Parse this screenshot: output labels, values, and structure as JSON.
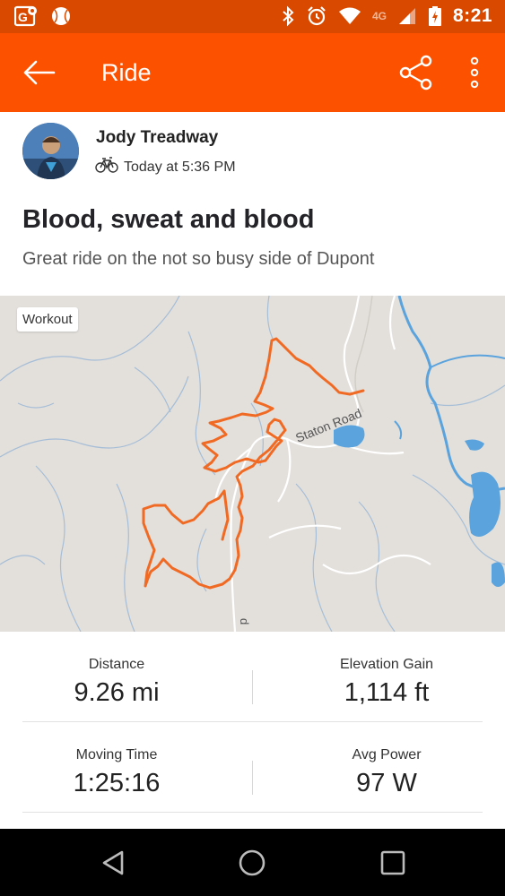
{
  "status_bar": {
    "time": "8:21",
    "network": "4G",
    "left_icons": [
      "google-maps-icon",
      "baseball-icon"
    ],
    "right_icons": [
      "bluetooth-icon",
      "alarm-icon",
      "wifi-icon",
      "signal-icon",
      "battery-icon"
    ]
  },
  "app_bar": {
    "title": "Ride",
    "background": "#fc5200",
    "icons": [
      "back-arrow-icon",
      "share-icon",
      "more-vert-icon"
    ]
  },
  "athlete": {
    "name": "Jody Treadway",
    "activity_icon": "bike-icon",
    "timestamp": "Today at 5:36 PM"
  },
  "activity": {
    "title": "Blood, sweat and blood",
    "description": "Great ride on the not so busy side of Dupont"
  },
  "map": {
    "badge": "Workout",
    "road_label": "Staton Road",
    "road_label_fragment": "d",
    "route_color": "#f06a24",
    "water_color": "#5ba3dd"
  },
  "stats": [
    {
      "left": {
        "label": "Distance",
        "value": "9.26 mi"
      },
      "right": {
        "label": "Elevation Gain",
        "value": "1,114 ft"
      }
    },
    {
      "left": {
        "label": "Moving Time",
        "value": "1:25:16"
      },
      "right": {
        "label": "Avg Power",
        "value": "97 W"
      }
    }
  ],
  "nav_bar": {
    "icons": [
      "nav-back-icon",
      "nav-home-icon",
      "nav-recents-icon"
    ]
  }
}
